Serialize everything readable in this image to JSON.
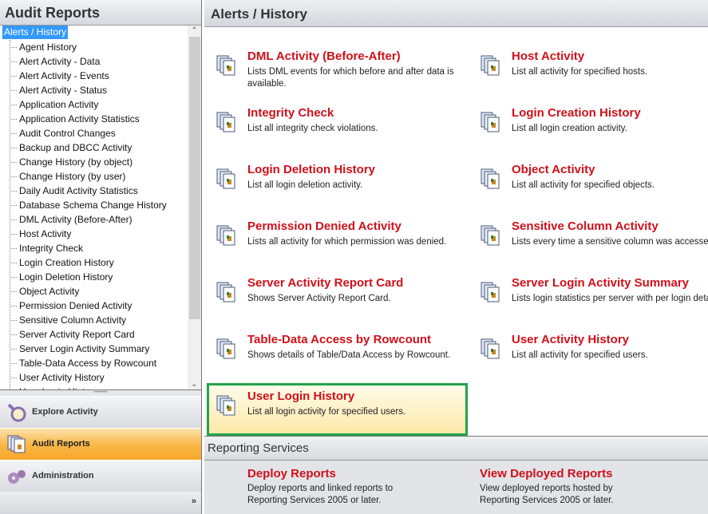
{
  "left": {
    "title": "Audit Reports",
    "tree_root": "Alerts /  History",
    "tree_items": [
      "Agent History",
      "Alert Activity - Data",
      "Alert Activity - Events",
      "Alert Activity - Status",
      "Application Activity",
      "Application Activity Statistics",
      "Audit Control Changes",
      "Backup and DBCC Activity",
      "Change History (by object)",
      "Change History (by user)",
      "Daily Audit Activity Statistics",
      "Database Schema Change History",
      "DML Activity (Before-After)",
      "Host Activity",
      "Integrity Check",
      "Login Creation History",
      "Login Deletion History",
      "Object Activity",
      "Permission Denied Activity",
      "Sensitive Column Activity",
      "Server Activity Report Card",
      "Server Login Activity Summary",
      "Table-Data Access by Rowcount",
      "User Activity History",
      "User Login History"
    ],
    "nav": [
      {
        "label": "Explore Activity"
      },
      {
        "label": "Audit Reports"
      },
      {
        "label": "Administration"
      }
    ]
  },
  "right": {
    "title": "Alerts /  History",
    "reports": [
      {
        "title": "DML Activity (Before-After)",
        "desc": "Lists DML events for which before and after data is available."
      },
      {
        "title": "Host Activity",
        "desc": "List all activity for specified hosts."
      },
      {
        "title": "Integrity Check",
        "desc": "List all integrity check violations."
      },
      {
        "title": "Login Creation History",
        "desc": "List all login creation activity."
      },
      {
        "title": "Login Deletion History",
        "desc": "List all login deletion activity."
      },
      {
        "title": "Object Activity",
        "desc": "List all activity for specified objects."
      },
      {
        "title": "Permission Denied Activity",
        "desc": "Lists all activity for which permission was denied."
      },
      {
        "title": "Sensitive Column Activity",
        "desc": "Lists every time a sensitive column was accessed."
      },
      {
        "title": "Server Activity Report Card",
        "desc": "Shows Server Activity Report Card."
      },
      {
        "title": "Server Login Activity Summary",
        "desc": "Lists login statistics per server with per login details."
      },
      {
        "title": "Table-Data Access by Rowcount",
        "desc": "Shows details of Table/Data Access by Rowcount."
      },
      {
        "title": "User Activity History",
        "desc": "List all activity for specified users."
      },
      {
        "title": "User Login History",
        "desc": "List all login activity for specified users."
      }
    ],
    "reporting_services": {
      "title": "Reporting Services",
      "deploy": {
        "title": "Deploy Reports",
        "desc": "Deploy reports and linked reports to Reporting Services 2005 or later."
      },
      "view": {
        "title": "View Deployed Reports",
        "desc": "View deployed reports hosted by Reporting Services 2005 or later."
      }
    }
  },
  "colors": {
    "accent": "#d0101a",
    "highlight_border": "#22a34a",
    "active_nav": "#f9b84a"
  }
}
